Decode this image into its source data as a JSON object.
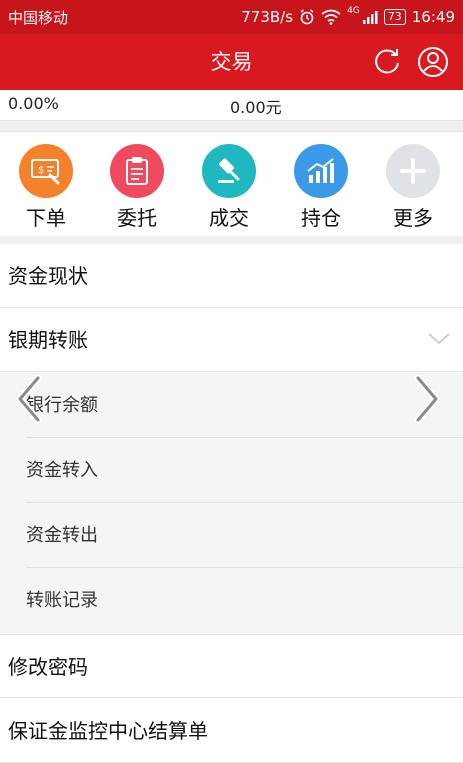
{
  "status_bar": {
    "carrier": "中国移动",
    "speed": "773B/s",
    "network": "4G",
    "battery": "73",
    "time": "16:49"
  },
  "app_bar": {
    "title": "交易"
  },
  "summary": {
    "percent": "0.00%",
    "amount": "0.00元"
  },
  "quick_actions": [
    {
      "label": "下单",
      "color": "#f5822a"
    },
    {
      "label": "委托",
      "color": "#ef4a5e"
    },
    {
      "label": "成交",
      "color": "#20b8c0"
    },
    {
      "label": "持仓",
      "color": "#3a9ae8"
    },
    {
      "label": "更多",
      "color": "#dfe3e8"
    }
  ],
  "menu": {
    "funds_status": "资金现状",
    "bank_transfer": "银期转账",
    "sub_items": [
      "银行余额",
      "资金转入",
      "资金转出",
      "转账记录"
    ],
    "change_password": "修改密码",
    "margin_statement": "保证金监控中心结算单"
  }
}
